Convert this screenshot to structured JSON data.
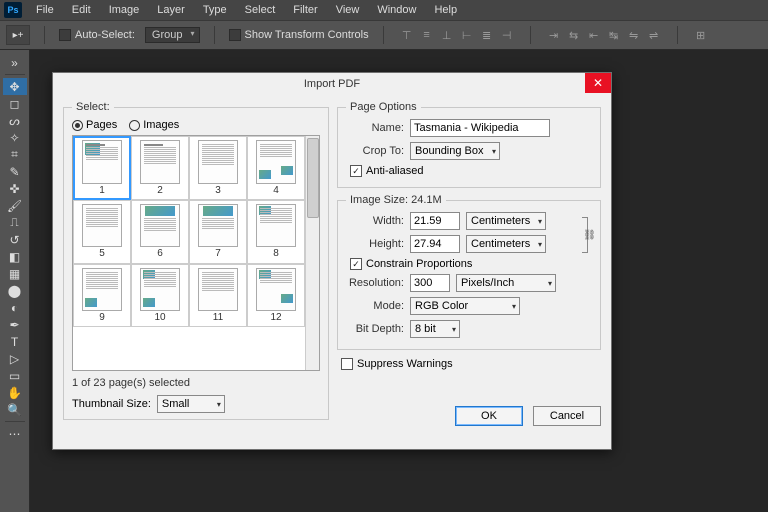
{
  "menubar": {
    "items": [
      "File",
      "Edit",
      "Image",
      "Layer",
      "Type",
      "Select",
      "Filter",
      "View",
      "Window",
      "Help"
    ]
  },
  "optbar": {
    "auto_select": "Auto-Select:",
    "group": "Group",
    "show_tc": "Show Transform Controls"
  },
  "dialog": {
    "title": "Import PDF",
    "select_legend": "Select:",
    "radio_pages": "Pages",
    "radio_images": "Images",
    "pages": [
      "1",
      "2",
      "3",
      "4",
      "5",
      "6",
      "7",
      "8",
      "9",
      "10",
      "11",
      "12"
    ],
    "status": "1 of 23 page(s) selected",
    "thumb_size_label": "Thumbnail Size:",
    "thumb_size_value": "Small",
    "page_options_legend": "Page Options",
    "name_label": "Name:",
    "name_value": "Tasmania - Wikipedia",
    "cropto_label": "Crop To:",
    "cropto_value": "Bounding Box",
    "antialiased": "Anti-aliased",
    "image_size_legend": "Image Size: 24.1M",
    "width_label": "Width:",
    "width_value": "21.59",
    "width_unit": "Centimeters",
    "height_label": "Height:",
    "height_value": "27.94",
    "height_unit": "Centimeters",
    "constrain": "Constrain Proportions",
    "res_label": "Resolution:",
    "res_value": "300",
    "res_unit": "Pixels/Inch",
    "mode_label": "Mode:",
    "mode_value": "RGB Color",
    "bitdepth_label": "Bit Depth:",
    "bitdepth_value": "8 bit",
    "suppress": "Suppress Warnings",
    "ok": "OK",
    "cancel": "Cancel"
  }
}
